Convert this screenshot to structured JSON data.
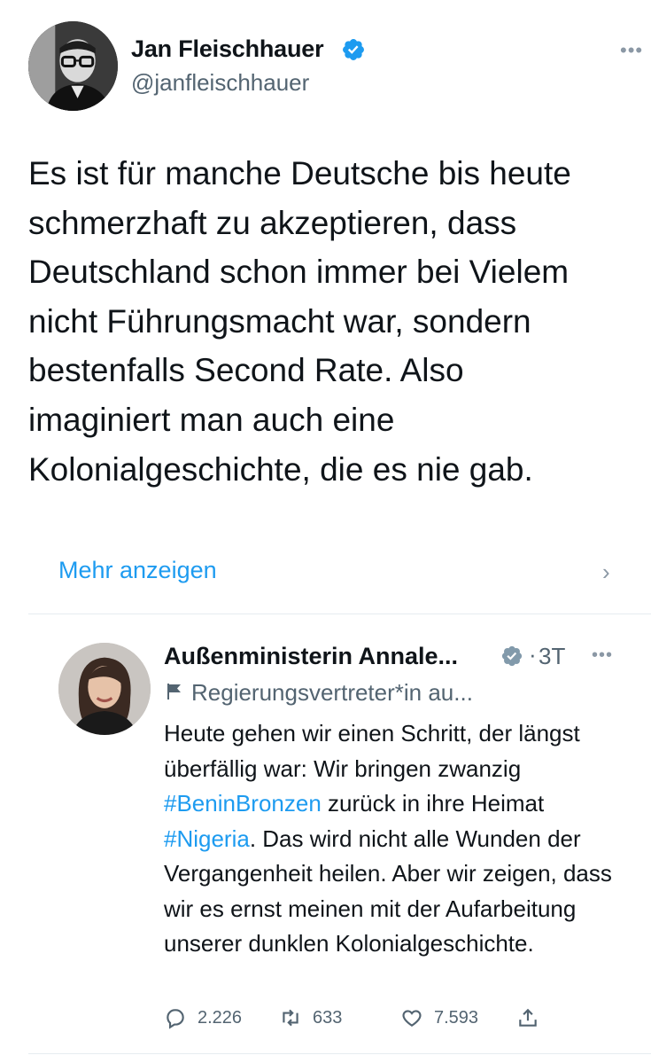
{
  "author": {
    "name": "Jan Fleischhauer",
    "handle": "@janfleischhauer",
    "avatar_icon": "profile-photo",
    "verified_icon": "verified-badge-icon"
  },
  "tweet": {
    "text": "Es ist für manche Deutsche bis heute\nschmerzhaft zu akzeptieren, dass\nDeutschland schon immer bei Vielem\nnicht Führungsmacht war, sondern\nbestenfalls Second Rate. Also\nimaginiert man auch eine\nKolonialgeschichte, die es nie gab.",
    "show_more": "Mehr anzeigen"
  },
  "quoted": {
    "name": "Außenministerin Annale...",
    "dot": "·",
    "time": "3T",
    "label": "Regierungsvertreter*in au...",
    "text_parts": {
      "p1": "Heute gehen wir einen Schritt, der längst überfällig war: Wir bringen zwanzig ",
      "tag1": "#BeninBronzen",
      "p2": " zurück in ihre Heimat ",
      "tag2": "#Nigeria",
      "p3": ". Das wird nicht alle Wunden der Vergangenheit heilen. Aber wir zeigen, dass wir es ernst meinen mit der Aufarbeitung unserer dunklen Kolonialgeschichte."
    },
    "actions": {
      "replies": "2.226",
      "retweets": "633",
      "likes": "7.593"
    }
  },
  "colors": {
    "link": "#1d9bf0",
    "verified": "#1d9bf0",
    "muted": "#536471",
    "text": "#0f1419"
  }
}
